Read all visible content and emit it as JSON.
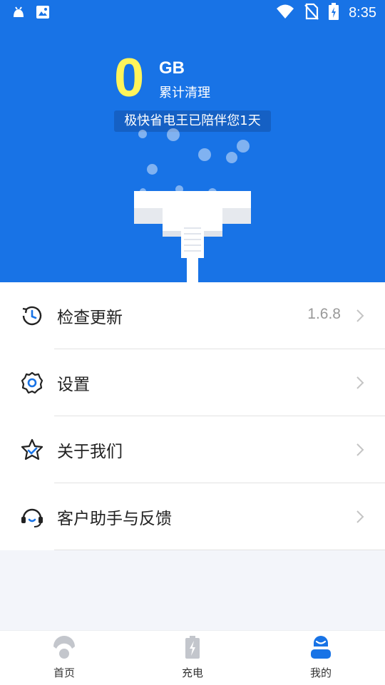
{
  "status_bar": {
    "time": "8:35",
    "left_icons": [
      "android-icon",
      "image-icon"
    ],
    "right_icons": [
      "wifi-icon",
      "no-sim-icon",
      "battery-charging-icon"
    ]
  },
  "stats": {
    "cleaned_amount": "0",
    "unit": "GB",
    "caption": "累计清理",
    "badge": "极快省电王已陪伴您1天"
  },
  "menu": {
    "items": [
      {
        "label": "检查更新",
        "value": "1.6.8",
        "icon": "update-clock-icon"
      },
      {
        "label": "设置",
        "value": "",
        "icon": "gear-icon"
      },
      {
        "label": "关于我们",
        "value": "",
        "icon": "star-icon"
      },
      {
        "label": "客户助手与反馈",
        "value": "",
        "icon": "headset-icon"
      }
    ]
  },
  "tabbar": {
    "tabs": [
      {
        "label": "首页",
        "icon": "home-icon",
        "active": false
      },
      {
        "label": "充电",
        "icon": "battery-charge-icon",
        "active": false
      },
      {
        "label": "我的",
        "icon": "profile-icon",
        "active": true
      }
    ]
  },
  "colors": {
    "hero_blue": "#1873e6",
    "accent_yellow": "#fff45a",
    "badge_blue": "#1560c4",
    "active_tab": "#1873e6"
  }
}
